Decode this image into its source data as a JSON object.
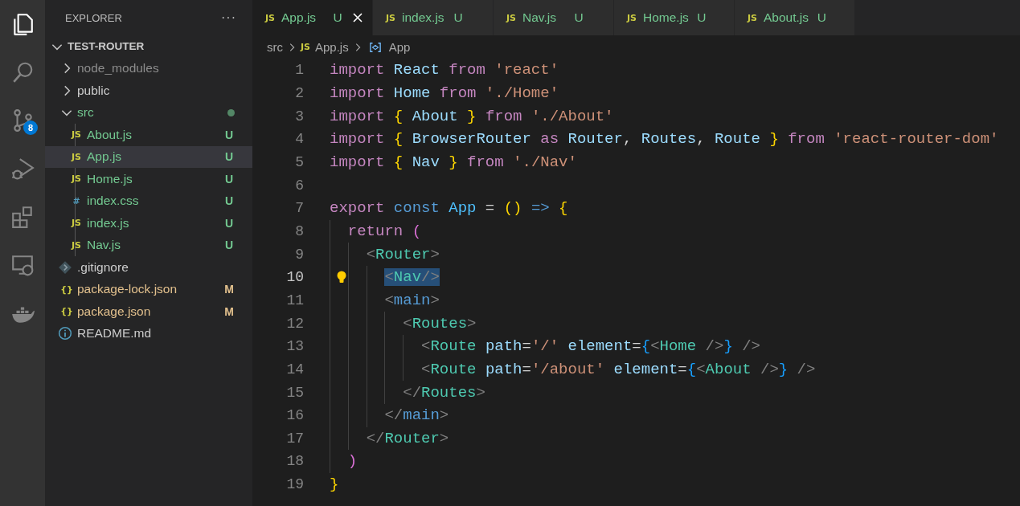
{
  "activity_bar": {
    "items": [
      {
        "kind": "files",
        "selected": true
      },
      {
        "kind": "search",
        "selected": false
      },
      {
        "kind": "source-control",
        "selected": false,
        "badge": "8"
      },
      {
        "kind": "run-debug",
        "selected": false
      },
      {
        "kind": "extensions",
        "selected": false
      },
      {
        "kind": "remote",
        "selected": false
      },
      {
        "kind": "docker",
        "selected": false
      }
    ]
  },
  "sidebar": {
    "title": "EXPLORER",
    "more": "···",
    "tree": [
      {
        "label": "TEST-ROUTER",
        "kind": "root",
        "expanded": true,
        "selected": false,
        "children": [
          {
            "label": "node_modules",
            "kind": "folder",
            "expanded": false,
            "selected": false,
            "color": "#8c8c8c"
          },
          {
            "label": "public",
            "kind": "folder",
            "expanded": false,
            "selected": false
          },
          {
            "label": "src",
            "kind": "folder",
            "expanded": true,
            "selected": false,
            "color": "#73c991",
            "dot": true,
            "children": [
              {
                "label": "About.js",
                "kind": "js",
                "glyph": "JS",
                "color": "#73c991",
                "badge": "U",
                "selected": false
              },
              {
                "label": "App.js",
                "kind": "js",
                "glyph": "JS",
                "color": "#73c991",
                "badge": "U",
                "selected": true
              },
              {
                "label": "Home.js",
                "kind": "js",
                "glyph": "JS",
                "color": "#73c991",
                "badge": "U",
                "selected": false
              },
              {
                "label": "index.css",
                "kind": "css",
                "glyph": "#",
                "color": "#73c991",
                "badge": "U",
                "selected": false
              },
              {
                "label": "index.js",
                "kind": "js",
                "glyph": "JS",
                "color": "#73c991",
                "badge": "U",
                "selected": false
              },
              {
                "label": "Nav.js",
                "kind": "js",
                "glyph": "JS",
                "color": "#73c991",
                "badge": "U",
                "selected": false
              }
            ]
          },
          {
            "label": ".gitignore",
            "kind": "git",
            "selected": false
          },
          {
            "label": "package-lock.json",
            "kind": "json",
            "glyph": "{}",
            "color": "#e2c08d",
            "badge": "M",
            "selected": false
          },
          {
            "label": "package.json",
            "kind": "json",
            "glyph": "{}",
            "color": "#e2c08d",
            "badge": "M",
            "selected": false
          },
          {
            "label": "README.md",
            "kind": "info",
            "selected": false
          }
        ]
      }
    ]
  },
  "tabs": [
    {
      "label": "App.js",
      "glyph": "JS",
      "badge": "U",
      "selected": true
    },
    {
      "label": "index.js",
      "glyph": "JS",
      "badge": "U",
      "selected": false
    },
    {
      "label": "Nav.js",
      "glyph": "JS",
      "badge": "U",
      "selected": false
    },
    {
      "label": "Home.js",
      "glyph": "JS",
      "badge": "U",
      "selected": false
    },
    {
      "label": "About.js",
      "glyph": "JS",
      "badge": "U",
      "selected": false
    }
  ],
  "breadcrumb": [
    {
      "label": "src",
      "kind": "folder"
    },
    {
      "label": "App.js",
      "kind": "js",
      "glyph": "JS"
    },
    {
      "label": "App",
      "kind": "symbol"
    }
  ],
  "editor": {
    "lines": [
      {
        "number": "1",
        "current": false,
        "tokens": [
          {
            "kind": "keyword",
            "text": "import "
          },
          {
            "kind": "variable",
            "text": "React "
          },
          {
            "kind": "keyword",
            "text": "from "
          },
          {
            "kind": "string",
            "text": "'react'"
          }
        ]
      },
      {
        "number": "2",
        "current": false,
        "tokens": [
          {
            "kind": "keyword",
            "text": "import "
          },
          {
            "kind": "variable",
            "text": "Home "
          },
          {
            "kind": "keyword",
            "text": "from "
          },
          {
            "kind": "string",
            "text": "'./Home'"
          }
        ]
      },
      {
        "number": "3",
        "current": false,
        "tokens": [
          {
            "kind": "keyword",
            "text": "import "
          },
          {
            "kind": "bracket1",
            "text": "{ "
          },
          {
            "kind": "variable",
            "text": "About "
          },
          {
            "kind": "bracket1",
            "text": "} "
          },
          {
            "kind": "keyword",
            "text": "from "
          },
          {
            "kind": "string",
            "text": "'./About'"
          }
        ]
      },
      {
        "number": "4",
        "current": false,
        "tokens": [
          {
            "kind": "keyword",
            "text": "import "
          },
          {
            "kind": "bracket1",
            "text": "{ "
          },
          {
            "kind": "variable",
            "text": "BrowserRouter "
          },
          {
            "kind": "keyword",
            "text": "as "
          },
          {
            "kind": "variable",
            "text": "Router"
          },
          {
            "kind": "plain",
            "text": ", "
          },
          {
            "kind": "variable",
            "text": "Routes"
          },
          {
            "kind": "plain",
            "text": ", "
          },
          {
            "kind": "variable",
            "text": "Route "
          },
          {
            "kind": "bracket1",
            "text": "} "
          },
          {
            "kind": "keyword",
            "text": "from "
          },
          {
            "kind": "string",
            "text": "'react-router-dom'"
          }
        ]
      },
      {
        "number": "5",
        "current": false,
        "tokens": [
          {
            "kind": "keyword",
            "text": "import "
          },
          {
            "kind": "bracket1",
            "text": "{ "
          },
          {
            "kind": "variable",
            "text": "Nav "
          },
          {
            "kind": "bracket1",
            "text": "} "
          },
          {
            "kind": "keyword",
            "text": "from "
          },
          {
            "kind": "string",
            "text": "'./Nav'"
          }
        ]
      },
      {
        "number": "6",
        "current": false
      },
      {
        "number": "7",
        "current": false,
        "tokens": [
          {
            "kind": "keyword",
            "text": "export "
          },
          {
            "kind": "storage",
            "text": "const "
          },
          {
            "kind": "constant",
            "text": "App "
          },
          {
            "kind": "plain",
            "text": "= "
          },
          {
            "kind": "bracket1",
            "text": "() "
          },
          {
            "kind": "storage",
            "text": "=> "
          },
          {
            "kind": "bracket1",
            "text": "{"
          }
        ]
      },
      {
        "number": "8",
        "current": false,
        "tokens": [
          {
            "kind": "keyword",
            "text": "  return "
          },
          {
            "kind": "bracket2",
            "text": "("
          }
        ]
      },
      {
        "number": "9",
        "current": false,
        "tokens": [
          {
            "kind": "punct",
            "text": "    <"
          },
          {
            "kind": "component",
            "text": "Router"
          },
          {
            "kind": "punct",
            "text": ">"
          }
        ]
      },
      {
        "number": "10",
        "current": true,
        "lightbulb": true,
        "tokens": [
          {
            "kind": "selection",
            "parts": [
              {
                "kind": "punct",
                "text": "      <"
              },
              {
                "kind": "component",
                "text": "Nav"
              },
              {
                "kind": "punct",
                "text": "/>"
              }
            ]
          }
        ]
      },
      {
        "number": "11",
        "current": false,
        "tokens": [
          {
            "kind": "punct",
            "text": "      <"
          },
          {
            "kind": "tag",
            "text": "main"
          },
          {
            "kind": "punct",
            "text": ">"
          }
        ]
      },
      {
        "number": "12",
        "current": false,
        "tokens": [
          {
            "kind": "punct",
            "text": "        <"
          },
          {
            "kind": "component",
            "text": "Routes"
          },
          {
            "kind": "punct",
            "text": ">"
          }
        ]
      },
      {
        "number": "13",
        "current": false,
        "tokens": [
          {
            "kind": "punct",
            "text": "          <"
          },
          {
            "kind": "component",
            "text": "Route "
          },
          {
            "kind": "attr",
            "text": "path"
          },
          {
            "kind": "plain",
            "text": "="
          },
          {
            "kind": "string",
            "text": "'/' "
          },
          {
            "kind": "attr",
            "text": "element"
          },
          {
            "kind": "plain",
            "text": "="
          },
          {
            "kind": "bracket3",
            "text": "{"
          },
          {
            "kind": "punct",
            "text": "<"
          },
          {
            "kind": "component",
            "text": "Home "
          },
          {
            "kind": "punct",
            "text": "/>"
          },
          {
            "kind": "bracket3",
            "text": "}"
          },
          {
            "kind": "punct",
            "text": " />"
          }
        ]
      },
      {
        "number": "14",
        "current": false,
        "tokens": [
          {
            "kind": "punct",
            "text": "          <"
          },
          {
            "kind": "component",
            "text": "Route "
          },
          {
            "kind": "attr",
            "text": "path"
          },
          {
            "kind": "plain",
            "text": "="
          },
          {
            "kind": "string",
            "text": "'/about' "
          },
          {
            "kind": "attr",
            "text": "element"
          },
          {
            "kind": "plain",
            "text": "="
          },
          {
            "kind": "bracket3",
            "text": "{"
          },
          {
            "kind": "punct",
            "text": "<"
          },
          {
            "kind": "component",
            "text": "About "
          },
          {
            "kind": "punct",
            "text": "/>"
          },
          {
            "kind": "bracket3",
            "text": "}"
          },
          {
            "kind": "punct",
            "text": " />"
          }
        ]
      },
      {
        "number": "15",
        "current": false,
        "tokens": [
          {
            "kind": "punct",
            "text": "        </"
          },
          {
            "kind": "component",
            "text": "Routes"
          },
          {
            "kind": "punct",
            "text": ">"
          }
        ]
      },
      {
        "number": "16",
        "current": false,
        "tokens": [
          {
            "kind": "punct",
            "text": "      </"
          },
          {
            "kind": "tag",
            "text": "main"
          },
          {
            "kind": "punct",
            "text": ">"
          }
        ]
      },
      {
        "number": "17",
        "current": false,
        "tokens": [
          {
            "kind": "punct",
            "text": "    </"
          },
          {
            "kind": "component",
            "text": "Router"
          },
          {
            "kind": "punct",
            "text": ">"
          }
        ]
      },
      {
        "number": "18",
        "current": false,
        "tokens": [
          {
            "kind": "bracket2",
            "text": "  )"
          }
        ]
      },
      {
        "number": "19",
        "current": false,
        "tokens": [
          {
            "kind": "bracket1",
            "text": "}"
          }
        ]
      }
    ]
  }
}
